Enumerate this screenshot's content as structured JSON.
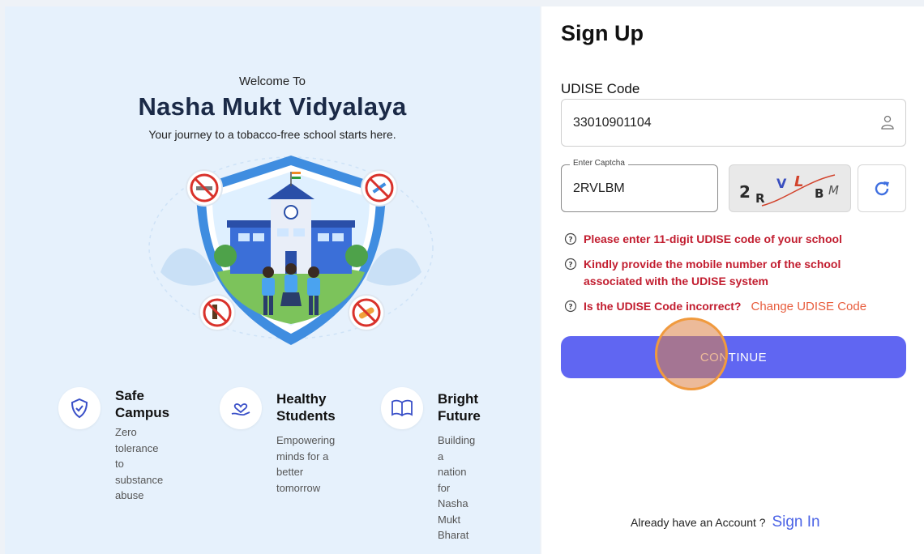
{
  "hero": {
    "welcome": "Welcome To",
    "brand": "Nasha Mukt Vidyalaya",
    "tagline": "Your journey to a tobacco-free school starts here."
  },
  "features": [
    {
      "icon": "shield-check-icon",
      "title1": "Safe",
      "title2": "Campus",
      "desc": [
        "Zero tolerance",
        "to substance",
        "abuse"
      ]
    },
    {
      "icon": "hand-heart-icon",
      "title1": "Healthy",
      "title2": "Students",
      "desc": [
        "Empowering",
        "minds for a",
        "better",
        "tomorrow"
      ]
    },
    {
      "icon": "book-icon",
      "title1": "Bright",
      "title2": "Future",
      "desc": [
        "Building a",
        "nation for",
        "Nasha Mukt",
        "Bharat"
      ]
    }
  ],
  "form": {
    "title": "Sign Up",
    "udise_label": "UDISE Code",
    "udise_value": "33010901104",
    "captcha_label": "Enter Captcha",
    "captcha_value": "2RVLBM",
    "captcha_chars": [
      "2",
      "R",
      "V",
      "L",
      "B",
      "M"
    ],
    "hints": [
      "Please enter 11-digit UDISE code of your school",
      "Kindly provide the mobile number of the school associated with the UDISE system",
      "Is the UDISE Code incorrect?"
    ],
    "change_link": "Change UDISE Code",
    "continue_label": "CONTINUE",
    "signin_prompt": "Already have an Account ?",
    "signin_link": "Sign In"
  },
  "colors": {
    "accent": "#6066f2",
    "error": "#c21d2f",
    "link": "#e85d3d",
    "hero_bg": "#e6f1fc"
  }
}
